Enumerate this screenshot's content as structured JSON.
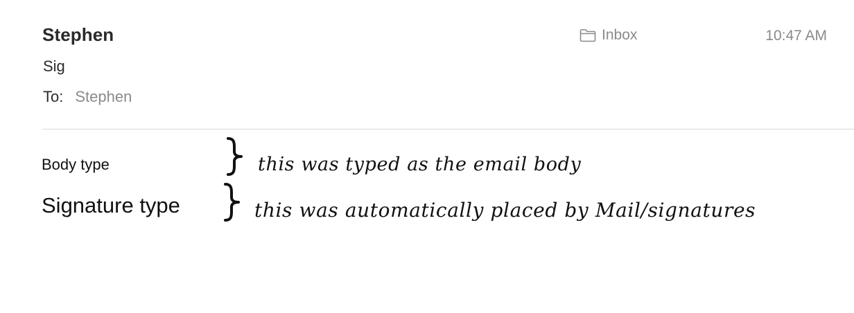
{
  "message": {
    "sender": "Stephen",
    "mailbox": "Inbox",
    "mailbox_icon": "folder-icon",
    "time": "10:47 AM",
    "subject": "Sig",
    "to_label": "To:",
    "to_value": "Stephen"
  },
  "body": {
    "body_text": "Body type",
    "signature_text": "Signature type"
  },
  "annotations": {
    "body_note": "this was typed as the email body",
    "signature_note": "this was automatically placed by Mail/signatures"
  }
}
